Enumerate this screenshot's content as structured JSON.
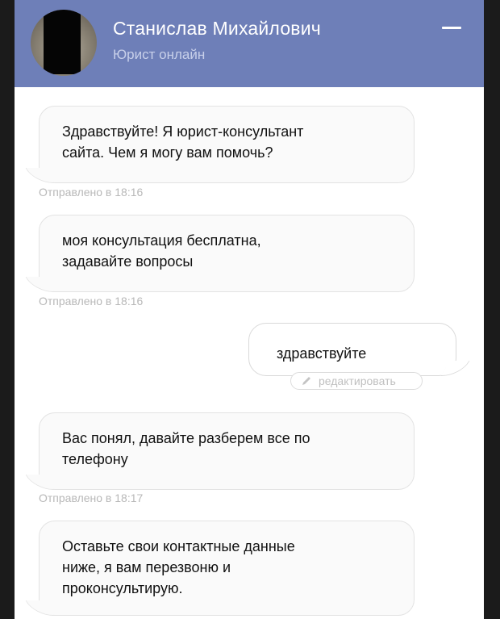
{
  "header": {
    "operator_name": "Станислав Михайлович",
    "operator_status": "Юрист онлайн",
    "minimize_icon": "minimize-icon"
  },
  "messages": [
    {
      "from": "operator",
      "text_lines": [
        "Здравствуйте! Я юрист-консультант",
        "сайта. Чем я могу вам помочь?"
      ],
      "time": "Отправлено в 18:16"
    },
    {
      "from": "operator",
      "text_lines": [
        "моя консультация бесплатна,",
        "задавайте вопросы"
      ],
      "time": "Отправлено в 18:16"
    },
    {
      "from": "user",
      "text_lines": [
        "здравствуйте"
      ],
      "edit_label": "редактировать"
    },
    {
      "from": "operator",
      "text_lines": [
        "Вас понял, давайте разберем все по",
        "телефону"
      ],
      "time": "Отправлено в 18:17"
    },
    {
      "from": "operator",
      "text_lines": [
        "Оставьте свои контактные данные",
        "ниже, я вам перезвоню и",
        "проконсультирую."
      ]
    }
  ],
  "colors": {
    "header_bg": "#6e7fb8",
    "window_bg": "#ffffff",
    "outer_bg": "#1b1b1b",
    "bubble_bg": "#fafafa",
    "time_text": "#b8b8b8"
  }
}
